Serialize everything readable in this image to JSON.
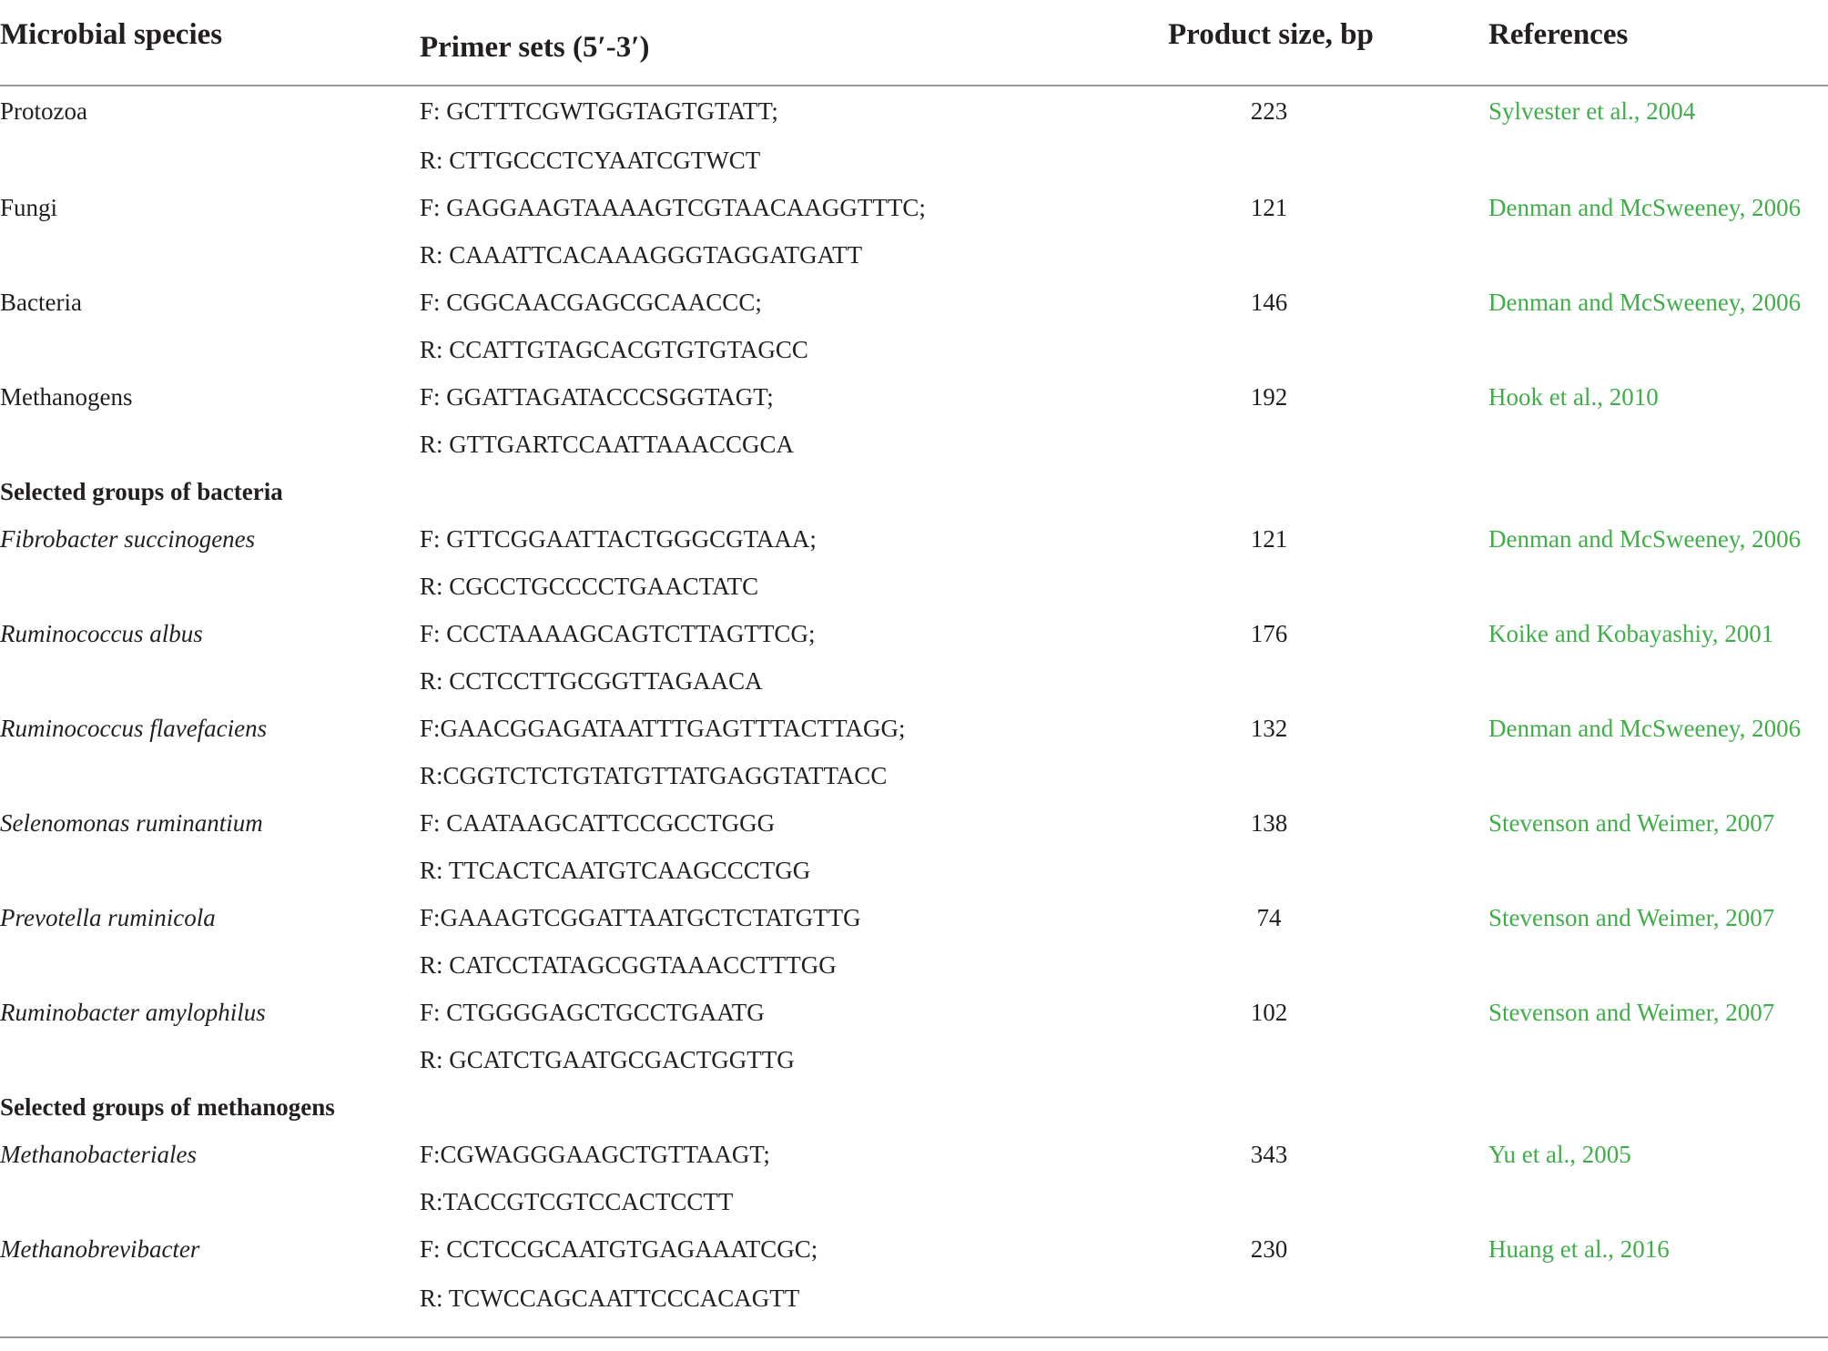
{
  "headers": {
    "species": "Microbial species",
    "primers": "Primer sets (5′-3′)",
    "size": "Product size, bp",
    "references": "References"
  },
  "colors": {
    "reference_link": "#3fae49",
    "rule": "#9a9a9a",
    "text": "#231f20"
  },
  "rows": [
    {
      "species": "Protozoa",
      "primer": "F: GCTTTCGWTGGTAGTGTATT;",
      "size": "223",
      "reference": "Sylvester et al., 2004"
    },
    {
      "species": "",
      "primer": "R: CTTGCCCTCYAATCGTWCT",
      "size": "",
      "reference": ""
    },
    {
      "species": "Fungi",
      "primer": "F: GAGGAAGTAAAAGTCGTAACAAGGTTTC;",
      "size": "121",
      "reference": "Denman and McSweeney, 2006"
    },
    {
      "species": "",
      "primer": "R: CAAATTCACAAAGGGTAGGATGATT",
      "size": "",
      "reference": ""
    },
    {
      "species": "Bacteria",
      "primer": "F: CGGCAACGAGCGCAACCC;",
      "size": "146",
      "reference": "Denman and McSweeney, 2006"
    },
    {
      "species": "",
      "primer": "R: CCATTGTAGCACGTGTGTAGCC",
      "size": "",
      "reference": ""
    },
    {
      "species": "Methanogens",
      "primer": "F: GGATTAGATACCCSGGTAGT;",
      "size": "192",
      "reference": "Hook et al., 2010"
    },
    {
      "species": "",
      "primer": "R: GTTGARTCCAATTAAACCGCA",
      "size": "",
      "reference": ""
    },
    {
      "section": "Selected groups of bacteria"
    },
    {
      "species": "Fibrobacter succinogenes",
      "italic": true,
      "primer": "F: GTTCGGAATTACTGGGCGTAAA;",
      "size": "121",
      "reference": "Denman and McSweeney, 2006"
    },
    {
      "species": "",
      "primer": "R: CGCCTGCCCCTGAACTATC",
      "size": "",
      "reference": ""
    },
    {
      "species": "Ruminococcus albus",
      "italic": true,
      "primer": "F: CCCTAAAAGCAGTCTTAGTTCG;",
      "size": "176",
      "reference": "Koike and Kobayashiy, 2001"
    },
    {
      "species": "",
      "primer": "R: CCTCCTTGCGGTTAGAACA",
      "size": "",
      "reference": ""
    },
    {
      "species": "Ruminococcus flavefaciens",
      "italic": true,
      "primer": "F:GAACGGAGATAATTTGAGTTTACTTAGG;",
      "size": "132",
      "reference": "Denman and McSweeney, 2006"
    },
    {
      "species": "",
      "primer": "R:CGGTCTCTGTATGTTATGAGGTATTACC",
      "size": "",
      "reference": ""
    },
    {
      "species": "Selenomonas ruminantium",
      "italic": true,
      "primer": "F: CAATAAGCATTCCGCCTGGG",
      "size": "138",
      "reference": "Stevenson and Weimer, 2007"
    },
    {
      "species": "",
      "primer": "R: TTCACTCAATGTCAAGCCCTGG",
      "size": "",
      "reference": ""
    },
    {
      "species": "Prevotella ruminicola",
      "italic": true,
      "primer": "F:GAAAGTCGGATTAATGCTCTATGTTG",
      "size": "74",
      "reference": "Stevenson and Weimer, 2007"
    },
    {
      "species": "",
      "primer": "R: CATCCTATAGCGGTAAACCTTTGG",
      "size": "",
      "reference": ""
    },
    {
      "species": "Ruminobacter amylophilus",
      "italic": true,
      "primer": "F: CTGGGGAGCTGCCTGAATG",
      "size": "102",
      "reference": "Stevenson and Weimer, 2007"
    },
    {
      "species": "",
      "primer": "R: GCATCTGAATGCGACTGGTTG",
      "size": "",
      "reference": ""
    },
    {
      "section": "Selected groups of methanogens"
    },
    {
      "species": "Methanobacteriales",
      "italic": true,
      "primer": "F:CGWAGGGAAGCTGTTAAGT;",
      "size": "343",
      "reference": "Yu et al., 2005"
    },
    {
      "species": "",
      "primer": "R:TACCGTCGTCCACTCCTT",
      "size": "",
      "reference": ""
    },
    {
      "species": "Methanobrevibacter",
      "italic": true,
      "primer": "F: CCTCCGCAATGTGAGAAATCGC;",
      "size": "230",
      "reference": "Huang et al., 2016"
    },
    {
      "species": "",
      "primer": "R: TCWCCAGCAATTCCCACAGTT",
      "size": "",
      "reference": ""
    }
  ]
}
